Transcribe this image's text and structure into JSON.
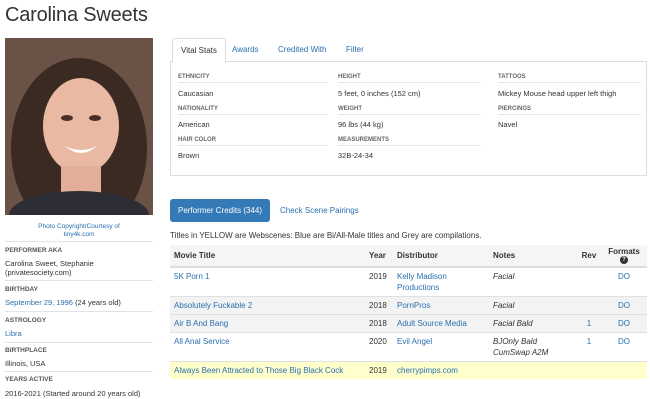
{
  "performer": {
    "name": "Carolina Sweets",
    "photo_credit_line1": "Photo Copyright/Courtesy of",
    "photo_credit_line2": "tiny4k.com"
  },
  "bio": {
    "aka_label": "Performer AKA",
    "aka_value": "Carolina Sweet, Stephanie (privatesociety.com)",
    "birthday_label": "Birthday",
    "birthday_date": "September 29, 1996",
    "birthday_age": "(24 years old)",
    "astrology_label": "Astrology",
    "astrology_value": "Libra",
    "birthplace_label": "Birthplace",
    "birthplace_value": "Illinois, USA",
    "years_active_label": "Years Active",
    "years_active_value": "2016-2021 (Started around 20 years old)"
  },
  "tabs": [
    {
      "label": "Vital Stats",
      "active": true
    },
    {
      "label": "Awards",
      "active": false
    },
    {
      "label": "Credited With",
      "active": false
    },
    {
      "label": "Filter",
      "active": false
    }
  ],
  "vital_stats": {
    "ethnicity_label": "Ethnicity",
    "ethnicity_value": "Caucasian",
    "nationality_label": "Nationality",
    "nationality_value": "American",
    "hair_label": "Hair Color",
    "hair_value": "Brown",
    "height_label": "Height",
    "height_value": "5 feet, 0 inches (152 cm)",
    "weight_label": "Weight",
    "weight_value": "96 lbs (44 kg)",
    "measurements_label": "Measurements",
    "measurements_value": "32B-24-34",
    "tattoos_label": "Tattoos",
    "tattoos_value": "Mickey Mouse head upper left thigh",
    "piercings_label": "Piercings",
    "piercings_value": "Navel"
  },
  "credits": {
    "performer_credits_button": "Performer Credits (344)",
    "scene_pairings_link": "Check Scene Pairings",
    "legend": "Titles in YELLOW are Webscenes: Blue are Bi/All-Male titles and Grey are compilations.",
    "columns": {
      "title": "Movie Title",
      "year": "Year",
      "distributor": "Distributor",
      "notes": "Notes",
      "rev": "Rev",
      "formats": "Formats",
      "formats_help": "?"
    },
    "rows": [
      {
        "title": "5K Porn 1",
        "year": "2019",
        "distributor": "Kelly Madison Productions",
        "notes": "Facial",
        "rev": "",
        "formats": "DO"
      },
      {
        "title": "Absolutely Fuckable 2",
        "year": "2018",
        "distributor": "PornPros",
        "notes": "Facial",
        "rev": "",
        "formats": "DO"
      },
      {
        "title": "Air B And Bang",
        "year": "2018",
        "distributor": "Adult Source Media",
        "notes": "Facial Bald",
        "rev": "1",
        "formats": "DO"
      },
      {
        "title": "All Anal Service",
        "year": "2020",
        "distributor": "Evil Angel",
        "notes": "BJOnly Bald CumSwap A2M",
        "rev": "1",
        "formats": "DO"
      },
      {
        "title": "Always Been Attracted to Those Big Black Cock",
        "year": "2019",
        "distributor": "cherrypimps.com",
        "notes": "",
        "rev": "",
        "formats": ""
      }
    ]
  }
}
